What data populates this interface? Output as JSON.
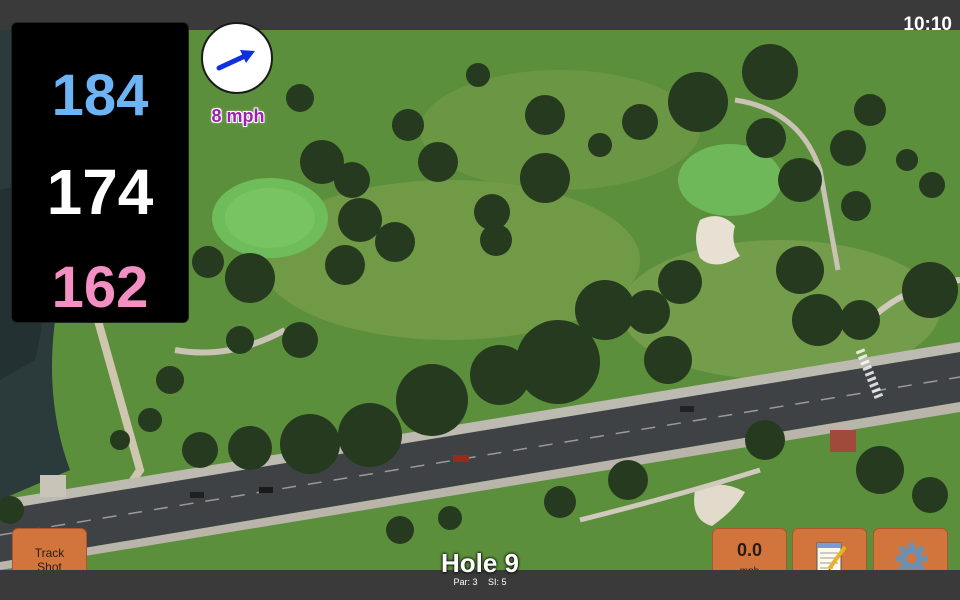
{
  "status_bar": {
    "time": "10:10"
  },
  "distances": {
    "back": {
      "value": "184",
      "color": "#6cb4f5"
    },
    "middle": {
      "value": "174",
      "color": "#ffffff"
    },
    "front": {
      "value": "162",
      "color": "#f48fc4"
    }
  },
  "wind": {
    "speed": "8 mph",
    "direction_icon": "arrow-icon",
    "arrow_color": "#1030e0",
    "text_color": "#9b1fb0"
  },
  "track_shot_button": {
    "line1": "Track",
    "line2": "Shot"
  },
  "speed_button": {
    "value": "0.0",
    "unit": "mph"
  },
  "notes_button": {
    "icon": "notepad-icon"
  },
  "settings_button": {
    "icon": "gear-icon"
  },
  "hole": {
    "title": "Hole 9",
    "par": "Par: 3",
    "si": "SI: 5"
  },
  "colors": {
    "button_bg": "#d2753c",
    "fairway": "#5f9a3e",
    "green": "#6cb556"
  }
}
